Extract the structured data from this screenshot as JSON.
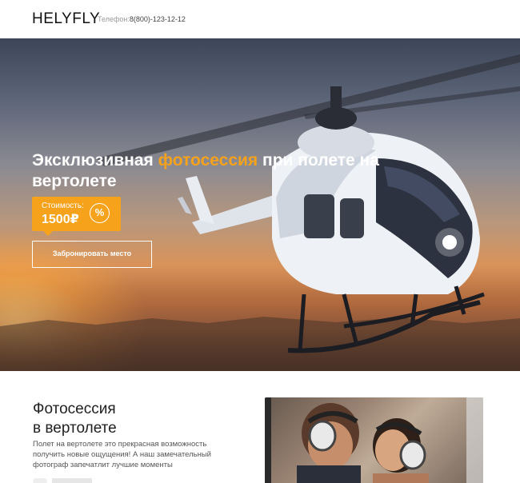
{
  "header": {
    "logo": "HELYFLY",
    "phone_label": "Телефон:",
    "phone_number": "8(800)-123-12-12"
  },
  "hero": {
    "title_part1": "Эксклюзивная ",
    "title_accent": "фотосессия",
    "title_part2": " при полете на вертолете",
    "price_label": "Стоимость:",
    "price_value": "1500₽",
    "percent_symbol": "%",
    "book_button": "Забронировать место"
  },
  "section": {
    "title_line1": "Фотосессия",
    "title_line2": "в вертолете",
    "text": "Полет на вертолете это прекрасная возможность получить новые ощущения! А наш замечательный фотограф запечатлит лучшие моменты"
  },
  "colors": {
    "accent": "#f7a21b",
    "text_dark": "#1f1f1f"
  },
  "icons": {
    "discount": "percent-icon"
  }
}
